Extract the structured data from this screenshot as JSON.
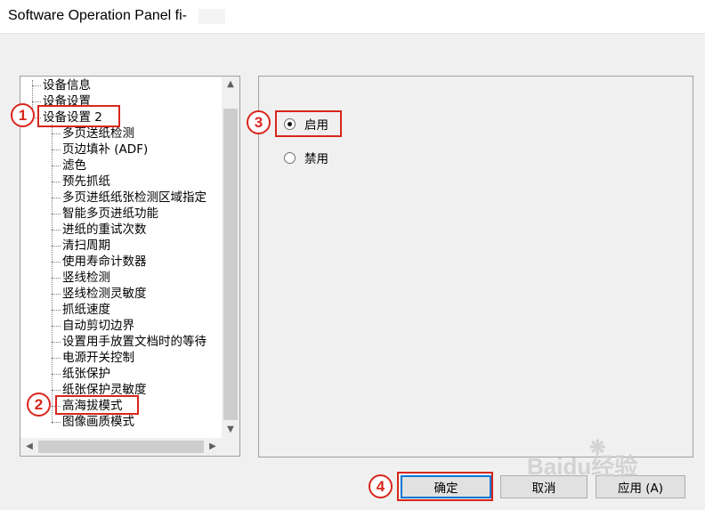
{
  "window": {
    "title": "Software Operation Panel fi-"
  },
  "tree": {
    "items": [
      {
        "label": "设备信息"
      },
      {
        "label": "设备设置"
      },
      {
        "label": "设备设置 2"
      },
      {
        "label": "多页送纸检测"
      },
      {
        "label": "页边填补 (ADF)"
      },
      {
        "label": "滤色"
      },
      {
        "label": "预先抓纸"
      },
      {
        "label": "多页进纸纸张检测区域指定"
      },
      {
        "label": "智能多页进纸功能"
      },
      {
        "label": "进纸的重试次数"
      },
      {
        "label": "清扫周期"
      },
      {
        "label": "使用寿命计数器"
      },
      {
        "label": "竖线检测"
      },
      {
        "label": "竖线检测灵敏度"
      },
      {
        "label": "抓纸速度"
      },
      {
        "label": "自动剪切边界"
      },
      {
        "label": "设置用手放置文档时的等待"
      },
      {
        "label": "电源开关控制"
      },
      {
        "label": "纸张保护"
      },
      {
        "label": "纸张保护灵敏度"
      },
      {
        "label": "高海拔模式"
      },
      {
        "label": "图像画质模式"
      }
    ]
  },
  "options": {
    "enable_label": "启用",
    "disable_label": "禁用",
    "selected": "enable"
  },
  "buttons": {
    "ok": "确定",
    "cancel": "取消",
    "apply": "应用 (A)"
  },
  "annotations": {
    "badge1": "1",
    "badge2": "2",
    "badge3": "3",
    "badge4": "4",
    "color": "#d9261c"
  },
  "icons": {
    "scroll_up": "▲",
    "scroll_down": "▼",
    "scroll_left": "◀",
    "scroll_right": "▶"
  },
  "watermark": {
    "text": "Baidu经验"
  }
}
